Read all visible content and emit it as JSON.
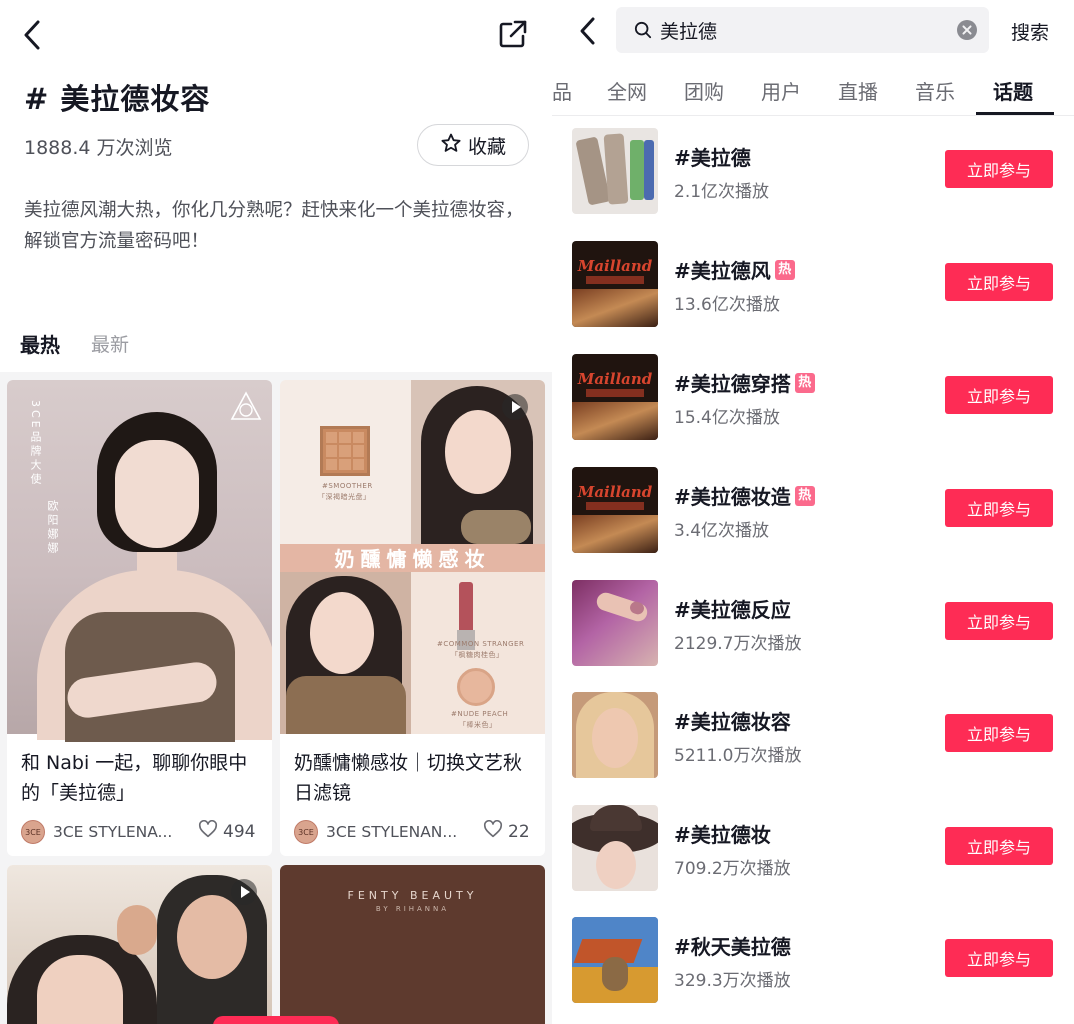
{
  "left": {
    "topic_title": "# 美拉德妆容",
    "views": "1888.4 万次浏览",
    "favorite_label": "收藏",
    "description": "美拉德风潮大热，你化几分熟呢？赶快来化一个美拉德妆容，解锁官方流量密码吧！",
    "tabs": {
      "hot": "最热",
      "new": "最新"
    },
    "cards": [
      {
        "title": "和 Nabi 一起，聊聊你眼中的「美拉德」",
        "author": "3CE STYLENA...",
        "likes": "494",
        "image_text": {
          "side_1": "3CE品牌大使",
          "side_2": "欧阳娜娜"
        }
      },
      {
        "title": "奶醺慵懒感妆｜切换文艺秋日滤镜",
        "author": "3CE STYLENAN...",
        "likes": "22",
        "image_text": {
          "band": "奶醺慵懒感妆",
          "smoother": "#SMOOTHER",
          "smoother_cn": "「深褐暗光盘」",
          "common": "#COMMON STRANGER",
          "common_cn": "「枫糖肉桂色」",
          "peach": "#NUDE PEACH",
          "peach_cn": "「棒米色」"
        }
      },
      {
        "title": "",
        "author": "",
        "likes": ""
      },
      {
        "title": "",
        "author": "",
        "likes": "",
        "image_text": {
          "brand": "FENTY BEAUTY",
          "sub": "BY RIHANNA"
        }
      }
    ]
  },
  "right": {
    "search_query": "美拉德",
    "search_button": "搜索",
    "tabs": [
      "品",
      "全网",
      "团购",
      "用户",
      "直播",
      "音乐",
      "话题"
    ],
    "active_tab": "话题",
    "results": [
      {
        "name": "#美拉德",
        "plays": "2.1亿次播放",
        "hot": false,
        "thumb": "scarf"
      },
      {
        "name": "#美拉德风",
        "plays": "13.6亿次播放",
        "hot": true,
        "thumb": "mailland"
      },
      {
        "name": "#美拉德穿搭",
        "plays": "15.4亿次播放",
        "hot": true,
        "thumb": "mailland"
      },
      {
        "name": "#美拉德妆造",
        "plays": "3.4亿次播放",
        "hot": true,
        "thumb": "mailland"
      },
      {
        "name": "#美拉德反应",
        "plays": "2129.7万次播放",
        "hot": false,
        "thumb": "hand"
      },
      {
        "name": "#美拉德妆容",
        "plays": "5211.0万次播放",
        "hot": false,
        "thumb": "face"
      },
      {
        "name": "#美拉德妆",
        "plays": "709.2万次播放",
        "hot": false,
        "thumb": "hat"
      },
      {
        "name": "#秋天美拉德",
        "plays": "329.3万次播放",
        "hot": false,
        "thumb": "autumn"
      }
    ],
    "join_label": "立即参与",
    "hot_badge": "热",
    "thumb_text": "Mailland"
  },
  "colors": {
    "accent_red": "#fe2c55",
    "hot_pink": "#fb6a8c",
    "text_primary": "#161823",
    "text_secondary": "#6b6c73"
  },
  "icons": {
    "left_back": "chevron-left-icon",
    "share": "share-icon",
    "favorite": "star-icon",
    "like": "heart-icon",
    "search": "search-icon",
    "clear": "clear-icon"
  }
}
